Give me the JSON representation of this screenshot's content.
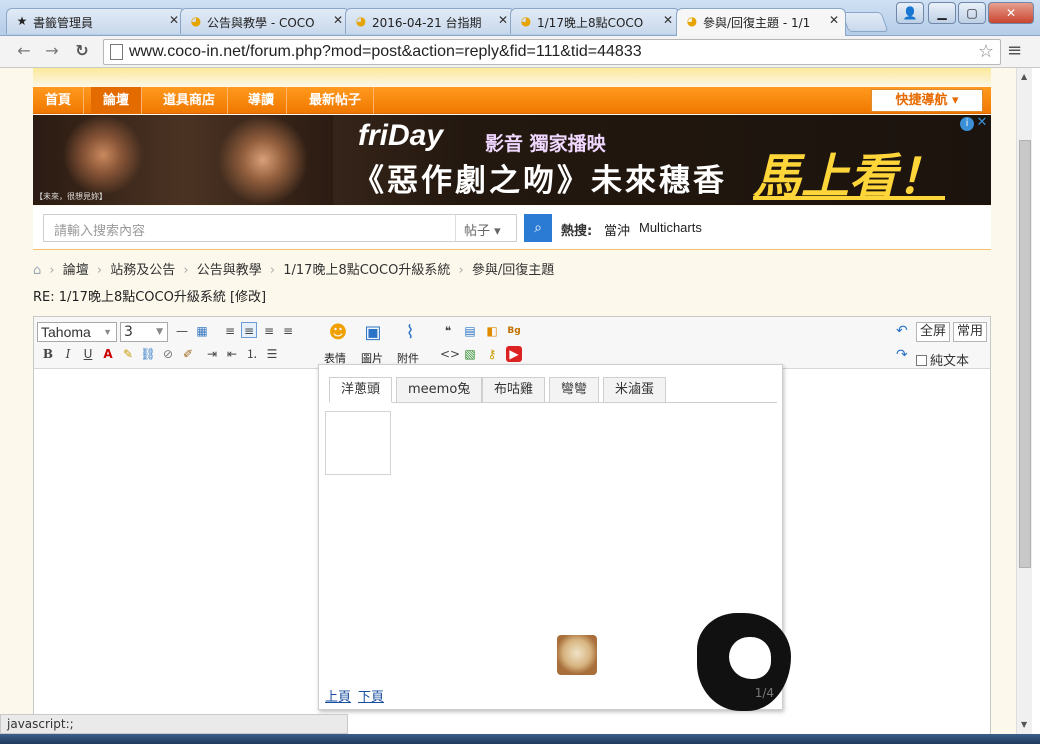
{
  "browser": {
    "tabs": [
      {
        "label": "書籤管理員",
        "icon": "star-icon"
      },
      {
        "label": "公告與教學 - COCO",
        "icon": "coco-favicon-icon"
      },
      {
        "label": "2016-04-21 台指期",
        "icon": "coco-favicon-icon"
      },
      {
        "label": "1/17晚上8點COCO",
        "icon": "coco-favicon-icon"
      },
      {
        "label": "參與/回復主題 - 1/1",
        "icon": "coco-favicon-icon",
        "active": true
      }
    ],
    "url": "www.coco-in.net/forum.php?mod=post&action=reply&fid=111&tid=44833",
    "status": "javascript:;"
  },
  "site": {
    "nav": [
      "首頁",
      "論壇",
      "道具商店",
      "導讀",
      "最新帖子"
    ],
    "active_nav": "論壇",
    "quick_nav": "快捷導航 ▾",
    "banner": {
      "caption": "【未來，很想見妳】",
      "logo": "friDay",
      "tagline": "影音 獨家播映",
      "title": "《惡作劇之吻》未來穗香",
      "cta": "馬上看！"
    },
    "search": {
      "placeholder": "請輸入搜索內容",
      "type": "帖子 ▾",
      "hot_label": "熱搜:",
      "hot": [
        "當沖",
        "Multicharts"
      ]
    },
    "breadcrumb": [
      "論壇",
      "站務及公告",
      "公告與教學",
      "1/17晚上8點COCO升級系統",
      "參與/回復主題"
    ],
    "reply_title": "RE: 1/17晚上8點COCO升級系統 [修改]"
  },
  "editor": {
    "font": "Tahoma",
    "size": "3",
    "labels": {
      "emoji": "表情",
      "image": "圖片",
      "attach": "附件"
    },
    "fullscreen": "全屏",
    "common": "常用",
    "plaintext": "純文本"
  },
  "smiley": {
    "tabs": [
      "洋蔥頭",
      "meemo兔",
      "布咕雞",
      "彎彎",
      "米滷蛋"
    ],
    "active_tab": "洋蔥頭",
    "prev": "上頁",
    "next": "下頁",
    "page": "1/4"
  }
}
